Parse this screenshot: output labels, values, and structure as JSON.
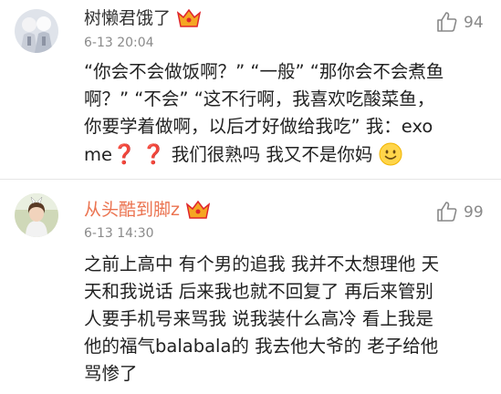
{
  "comments": [
    {
      "user": "树懒君饿了",
      "time": "6-13 20:04",
      "likes": "94",
      "line1": "“你会不会做饭啊？” “一般” “那你会不会煮鱼",
      "line2": "啊？” “不会” “这不行啊，我喜欢吃酸菜鱼，",
      "line3": "你要学着做啊，以后才好做给我吃” 我：exo",
      "line4_a": "me",
      "line4_q1": "❓",
      "line4_q2": "❓",
      "line4_b": "我们很熟吗 我又不是你妈",
      "line4_emoji": "smile-emoji"
    },
    {
      "user": "从头酷到脚z",
      "time": "6-13 14:30",
      "likes": "99",
      "line1": "之前上高中 有个男的追我 我并不太想理他 天",
      "line2": "天和我说话 后来我也就不回复了 再后来管别",
      "line3": "人要手机号来骂我 说我装什么高冷 看上我是",
      "line4": "他的福气balabala的 我去他大爷的 老子给他",
      "line5": "骂惨了"
    }
  ],
  "colors": {
    "username_highlight": "#eb7350",
    "vip_badge": "#f5a623",
    "question_mark": "#e0252c",
    "like_count": "#888888"
  },
  "icons": [
    "vip-crown-icon",
    "thumbs-up-icon",
    "smile-emoji"
  ]
}
